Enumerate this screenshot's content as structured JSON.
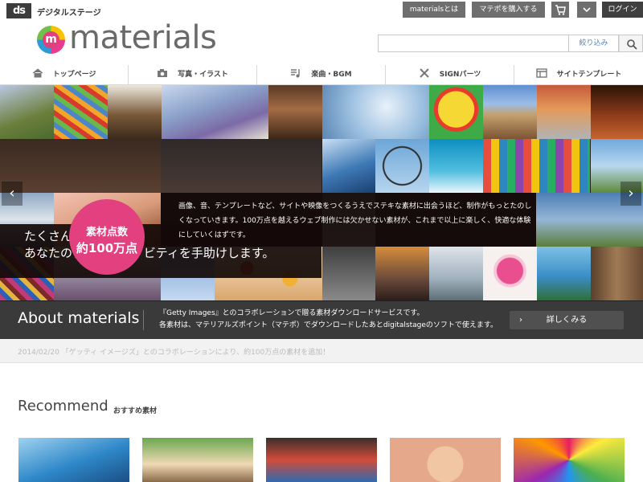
{
  "header": {
    "ds_logo": "ds",
    "brand": "デジタルステージ",
    "about_button": "materialsとは",
    "buy_points_button": "マテポを購入する",
    "cart_icon": "cart-icon",
    "dropdown_icon": "chevron-down-icon",
    "login_button": "ログイン"
  },
  "logo": {
    "mark": "m",
    "word": "materials"
  },
  "search": {
    "placeholder": "",
    "value": "",
    "filter_label": "絞り込み",
    "icon": "search-icon"
  },
  "nav": {
    "items": [
      {
        "label": "トップページ",
        "icon": "home-icon"
      },
      {
        "label": "写真・イラスト",
        "icon": "camera-icon"
      },
      {
        "label": "楽曲・BGM",
        "icon": "music-icon"
      },
      {
        "label": "SIGNパーツ",
        "icon": "tools-icon"
      },
      {
        "label": "サイトテンプレート",
        "icon": "template-icon"
      }
    ]
  },
  "hero": {
    "tagline": "たくさんの素材が、\nあなたのクリエイティビティを手助けします。",
    "description": "画像、音、テンプレートなど、サイトや映像をつくるうえでステキな素材に出会うほど、制作がもっとたのしくなっていきます。100万点を越えるウェブ制作には欠かせない素材が、これまで以上に楽しく、快適な体験にしていくはずです。",
    "badge_line1": "素材点数",
    "badge_line2": "約100万点",
    "prev_arrow": "‹",
    "next_arrow": "›"
  },
  "about": {
    "title": "About materials",
    "text": "『Getty Images』とのコラボレーションで贈る素材ダウンロードサービスです。\n各素材は、マテリアルズポイント（マテポ）でダウンロードしたあとdigitalstageのソフトで使えます。",
    "button_label": "詳しくみる",
    "button_chevron": "›"
  },
  "news": {
    "text": "2014/02/20 「ゲッティ イメージズ」とのコラボレーションにより、約100万点の素材を追加！"
  },
  "recommend": {
    "title": "Recommend",
    "subtitle": "おすすめ素材"
  },
  "colors": {
    "accent_pink": "#e2407f",
    "topbar_gray": "#6e6e6e",
    "about_band": "#3a3a3a"
  }
}
